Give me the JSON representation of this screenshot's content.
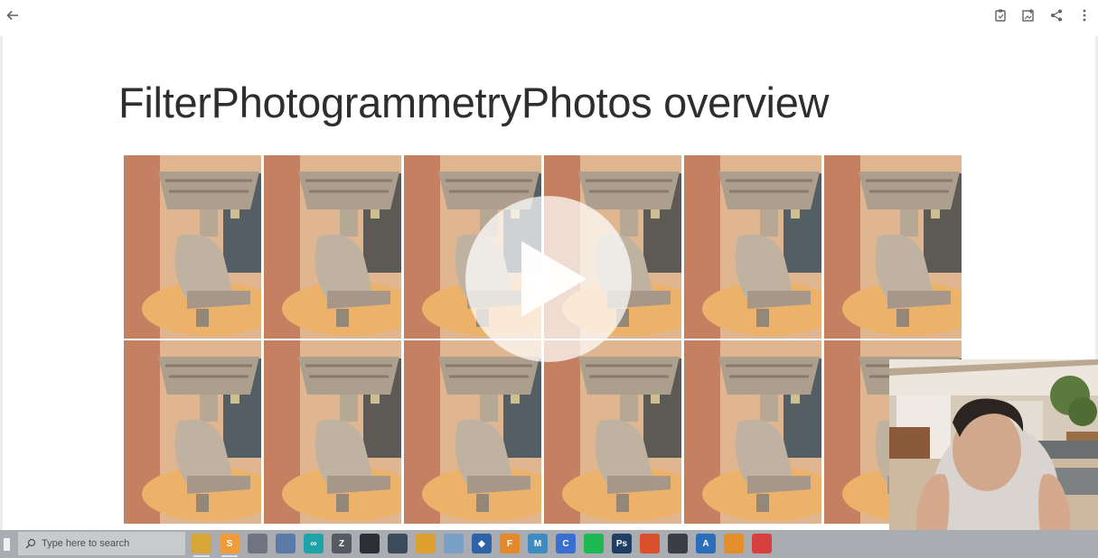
{
  "toolbar": {
    "back_icon": "arrow-left-icon",
    "right_icons": [
      "clipboard-icon",
      "add-to-drive-icon",
      "share-icon",
      "more-vert-icon"
    ]
  },
  "slide": {
    "title": "FilterPhotogrammetryPhotos overview",
    "photo_rows": 2,
    "photo_cols": 6
  },
  "player": {
    "play_icon": "play-icon"
  },
  "taskbar": {
    "search_placeholder": "Type here to search",
    "apps": [
      {
        "name": "file-explorer-icon",
        "glyph": "",
        "color": "#d8a637"
      },
      {
        "name": "sublime-text-icon",
        "glyph": "S",
        "color": "#f09c3a"
      },
      {
        "name": "davinci-icon",
        "glyph": "",
        "color": "#6f7480"
      },
      {
        "name": "calculator-icon",
        "glyph": "",
        "color": "#5c7aa6"
      },
      {
        "name": "arduino-icon",
        "glyph": "∞",
        "color": "#1ea4a8"
      },
      {
        "name": "zbrush-icon",
        "glyph": "Z",
        "color": "#555a60"
      },
      {
        "name": "terminal-icon",
        "glyph": "",
        "color": "#2b2e33"
      },
      {
        "name": "cmd-icon",
        "glyph": "",
        "color": "#3d4a5a"
      },
      {
        "name": "chrome-icon",
        "glyph": "",
        "color": "#e0a030"
      },
      {
        "name": "paint-icon",
        "glyph": "",
        "color": "#7aa0c8"
      },
      {
        "name": "hub-icon",
        "glyph": "◆",
        "color": "#2f63a8"
      },
      {
        "name": "fusion-icon",
        "glyph": "F",
        "color": "#e58a2c"
      },
      {
        "name": "maps-icon",
        "glyph": "M",
        "color": "#3e8ac2"
      },
      {
        "name": "code-icon",
        "glyph": "C",
        "color": "#3a6fd0"
      },
      {
        "name": "spotify-icon",
        "glyph": "",
        "color": "#1db954"
      },
      {
        "name": "photoshop-icon",
        "glyph": "Ps",
        "color": "#1f3e64"
      },
      {
        "name": "sketchup-icon",
        "glyph": "",
        "color": "#d9502a"
      },
      {
        "name": "obs-icon",
        "glyph": "",
        "color": "#3b3f45"
      },
      {
        "name": "autodesk-icon",
        "glyph": "A",
        "color": "#2a6ebb"
      },
      {
        "name": "blender-icon",
        "glyph": "",
        "color": "#e3902a"
      },
      {
        "name": "red-app-icon",
        "glyph": "",
        "color": "#d84040"
      }
    ]
  },
  "colors": {
    "taskbar": "#a9acb1",
    "photo_background": "#d9a679",
    "statue": "#9c8a75"
  }
}
